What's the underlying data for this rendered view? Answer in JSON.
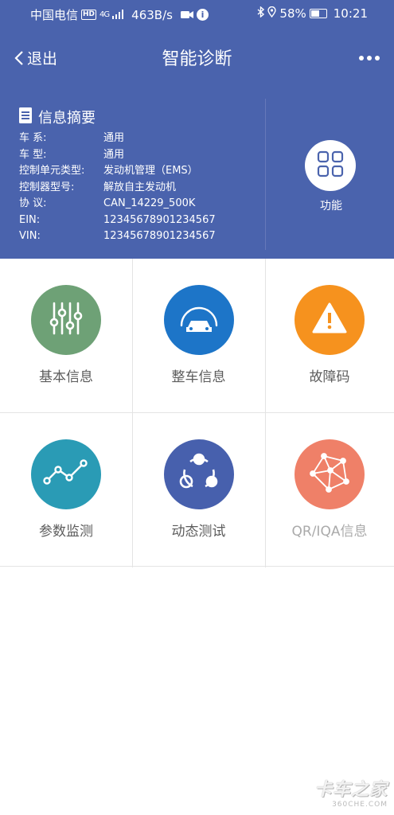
{
  "status_bar": {
    "carrier": "中国电信",
    "hd": "HD",
    "network": "4G",
    "speed": "463B/s",
    "battery": "58%",
    "time": "10:21"
  },
  "header": {
    "back_label": "退出",
    "title": "智能诊断"
  },
  "summary": {
    "heading": "信息摘要",
    "rows": [
      {
        "key": "车 系:",
        "value": "通用"
      },
      {
        "key": "车 型:",
        "value": "通用"
      },
      {
        "key": "控制单元类型:",
        "value": "发动机管理（EMS）"
      },
      {
        "key": "控制器型号:",
        "value": "解放自主发动机"
      },
      {
        "key": "协 议:",
        "value": "CAN_14229_500K"
      },
      {
        "key": "EIN:",
        "value": "12345678901234567"
      },
      {
        "key": "VIN:",
        "value": "12345678901234567"
      }
    ],
    "function_label": "功能"
  },
  "tiles": [
    {
      "label": "基本信息",
      "icon": "sliders-icon",
      "color": "#6ea176"
    },
    {
      "label": "整车信息",
      "icon": "car-icon",
      "color": "#1d75c8"
    },
    {
      "label": "故障码",
      "icon": "warning-icon",
      "color": "#f6921e"
    },
    {
      "label": "参数监测",
      "icon": "line-chart-icon",
      "color": "#2a9bb5"
    },
    {
      "label": "动态测试",
      "icon": "share-nodes-icon",
      "color": "#4760ad"
    },
    {
      "label": "QR/IQA信息",
      "icon": "network-icon",
      "color": "#ef8068"
    }
  ],
  "watermark": {
    "brand": "卡车之家",
    "domain": "360CHE.COM"
  }
}
